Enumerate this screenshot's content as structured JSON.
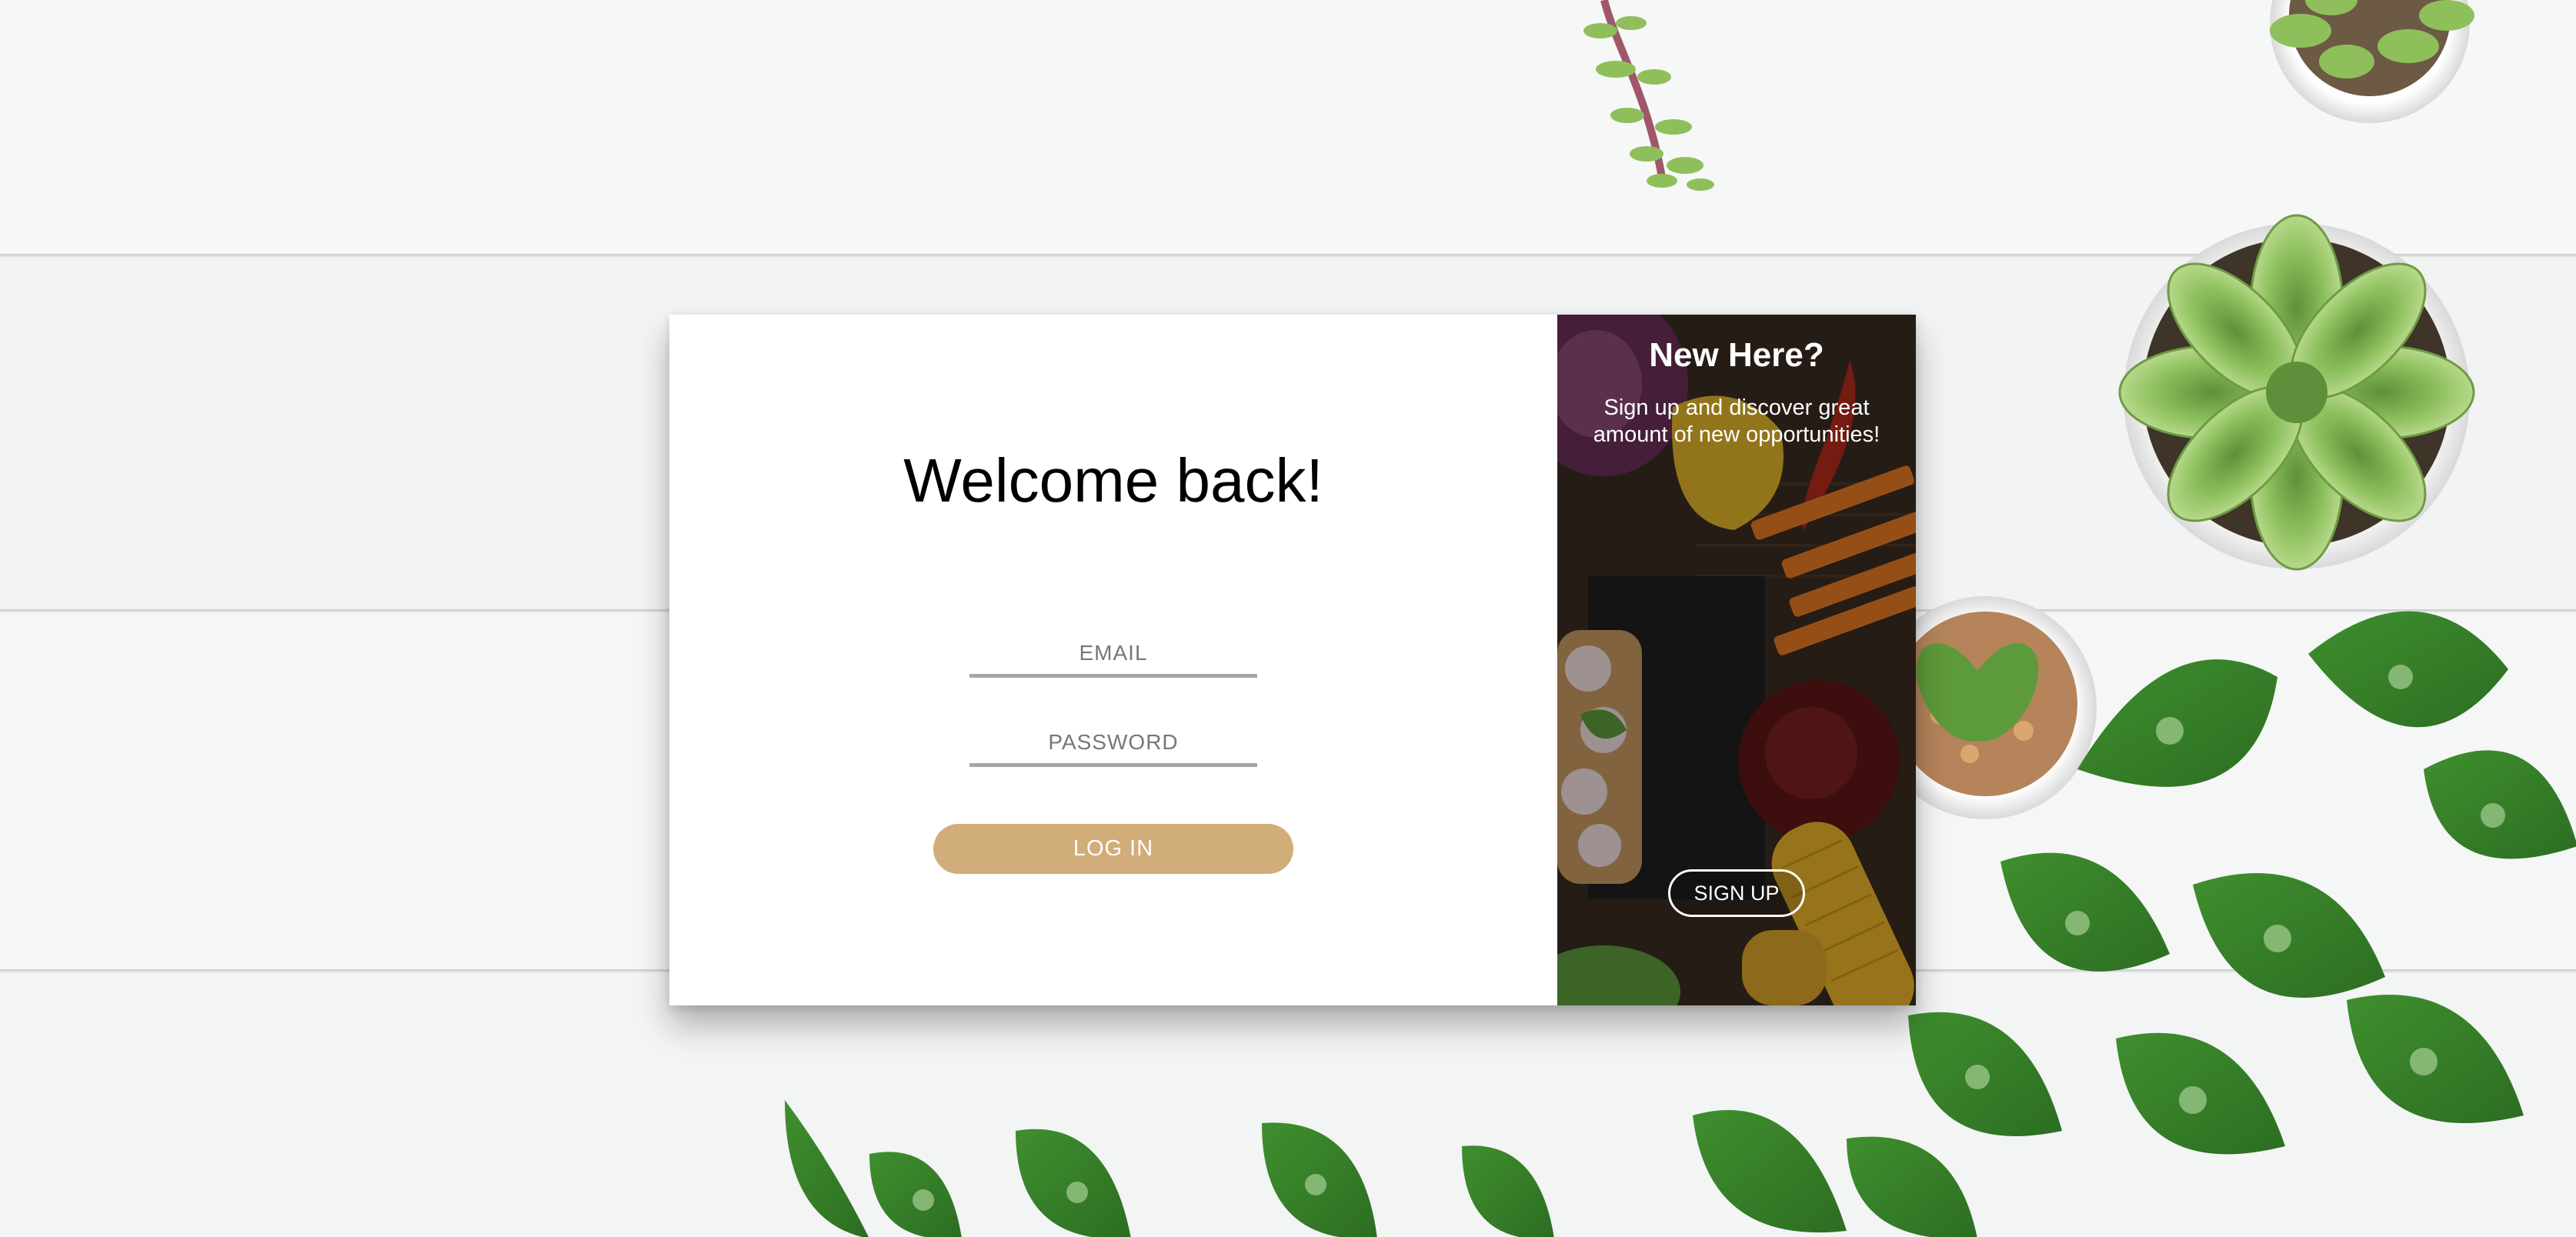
{
  "login": {
    "heading": "Welcome back!",
    "email_placeholder": "EMAIL",
    "password_placeholder": "PASSWORD",
    "login_button": "LOG IN",
    "button_color": "#d1ad7a"
  },
  "signup_panel": {
    "heading": "New Here?",
    "description": "Sign up and discover great amount of new opportunities!",
    "signup_button": "SIGN UP"
  },
  "background": {
    "description_icons": [
      "succulent-plant-icon",
      "pothos-leaf-icon",
      "wood-plank-table"
    ]
  }
}
